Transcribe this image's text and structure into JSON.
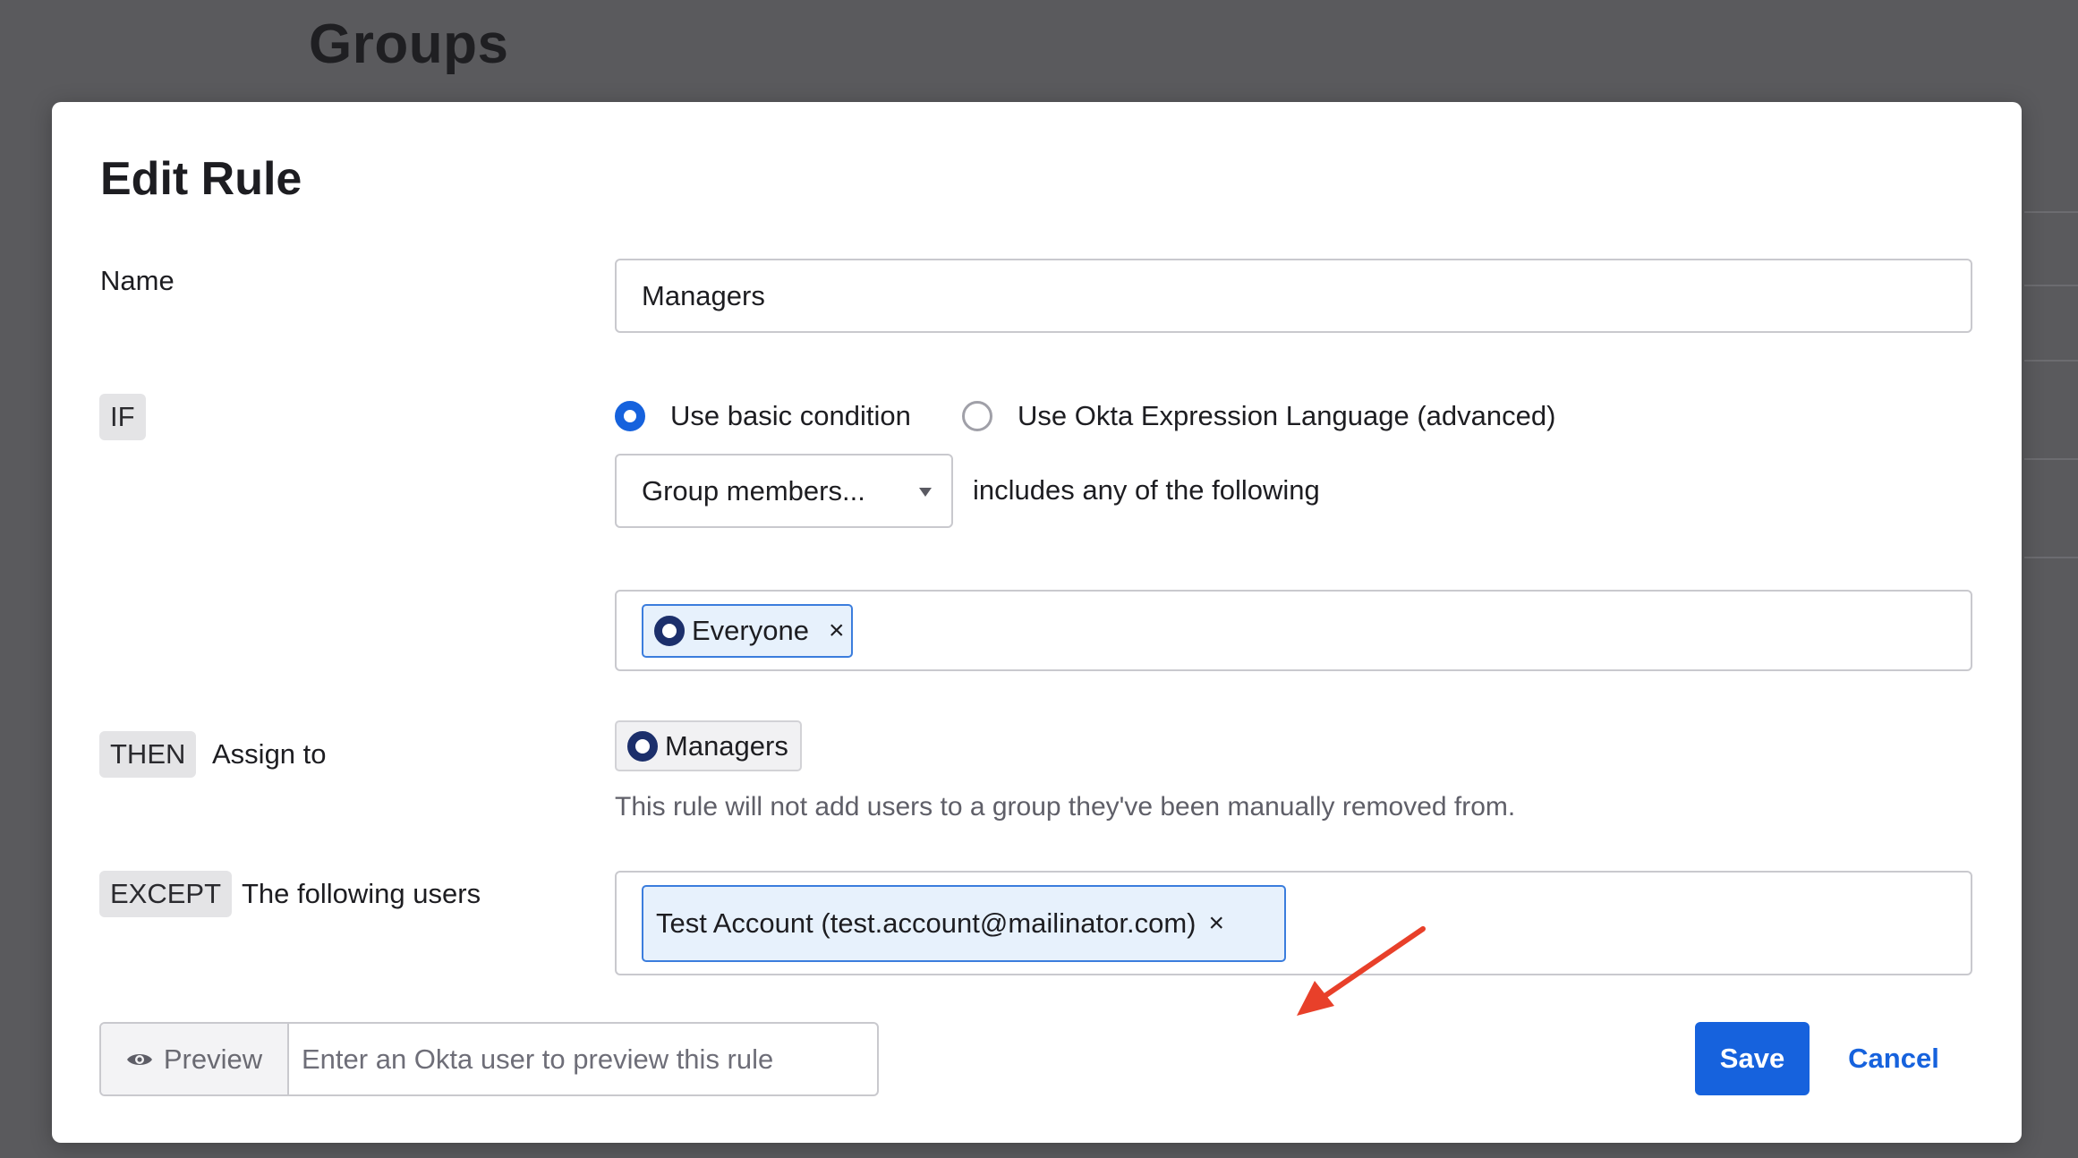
{
  "background": {
    "heading": "Groups"
  },
  "modal": {
    "title": "Edit Rule",
    "name": {
      "label": "Name",
      "value": "Managers"
    },
    "if_section": {
      "tag": "IF",
      "radio_basic_label": "Use basic condition",
      "radio_basic_checked": true,
      "radio_advanced_label": "Use Okta Expression Language (advanced)",
      "radio_advanced_checked": false,
      "select_value": "Group members...",
      "condition_text": "includes any of the following",
      "groups": [
        {
          "label": "Everyone",
          "icon": "group-icon"
        }
      ]
    },
    "then_section": {
      "tag": "THEN",
      "label": "Assign to",
      "group": {
        "label": "Managers",
        "icon": "group-icon"
      },
      "helper": "This rule will not add users to a group they've been manually removed from."
    },
    "except_section": {
      "tag": "EXCEPT",
      "label": "The following users",
      "users": [
        {
          "label": "Test Account (test.account@mailinator.com)"
        }
      ]
    },
    "footer": {
      "preview_label": "Preview",
      "preview_placeholder": "Enter an Okta user to preview this rule",
      "save_label": "Save",
      "cancel_label": "Cancel"
    }
  },
  "colors": {
    "primary": "#1662dd",
    "annotation_arrow": "#e8402a",
    "group_icon": "#1c2f6b",
    "overlay": "#5a5a5d"
  },
  "close_glyph": "×"
}
